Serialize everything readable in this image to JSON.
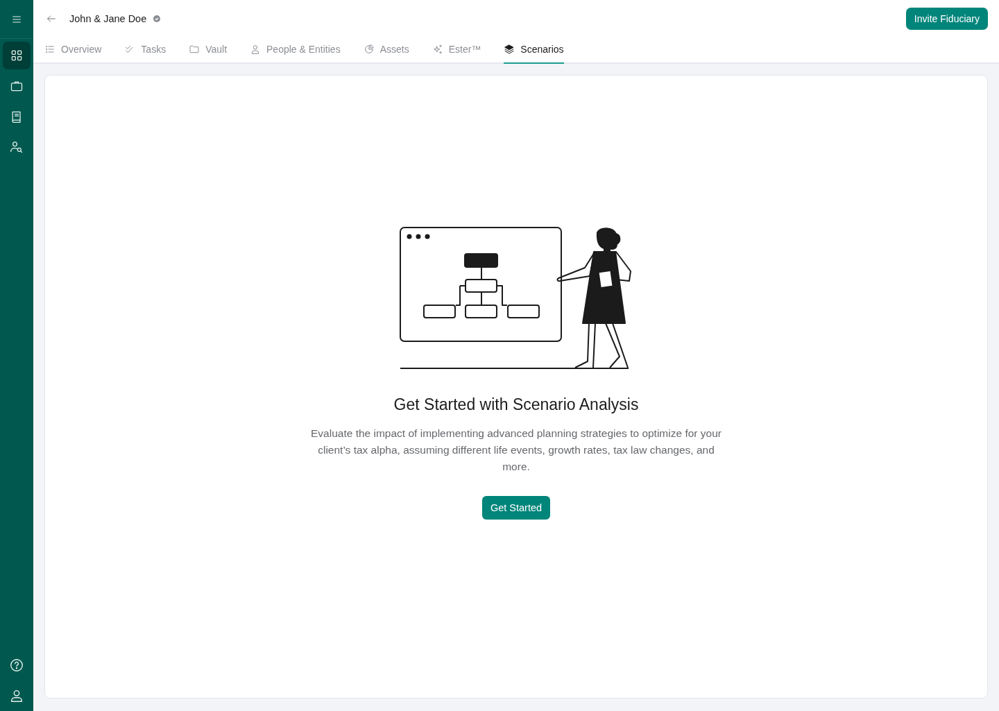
{
  "sidebar": {
    "items": [
      {
        "kind": "grid",
        "selected": true
      },
      {
        "kind": "briefcase",
        "selected": false
      },
      {
        "kind": "book",
        "selected": false
      },
      {
        "kind": "people-search",
        "selected": false
      }
    ],
    "bottom_items": [
      {
        "kind": "help"
      },
      {
        "kind": "user"
      }
    ]
  },
  "header": {
    "title": "John & Jane Doe",
    "verified": true,
    "action": "Invite Fiduciary"
  },
  "tabs": [
    {
      "label": "Overview",
      "kind": "list",
      "selected": false
    },
    {
      "label": "Tasks",
      "kind": "checks",
      "selected": false
    },
    {
      "label": "Vault",
      "kind": "folder",
      "selected": false
    },
    {
      "label": "People & Entities",
      "kind": "person",
      "selected": false
    },
    {
      "label": "Assets",
      "kind": "pie",
      "selected": false
    },
    {
      "label": "Ester™",
      "kind": "sparkle",
      "selected": false
    },
    {
      "label": "Scenarios",
      "kind": "layers",
      "selected": true
    }
  ],
  "empty_state": {
    "title": "Get Started with Scenario Analysis",
    "description": "Evaluate the impact of implementing advanced planning strategies to optimize for your client’s tax alpha, assuming different life events, growth rates, tax law changes, and more.",
    "button": "Get Started"
  }
}
